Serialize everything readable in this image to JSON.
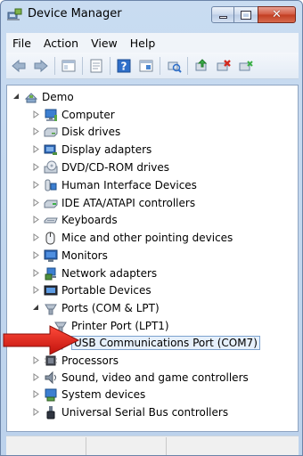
{
  "window": {
    "title": "Device Manager"
  },
  "menu": [
    "File",
    "Action",
    "View",
    "Help"
  ],
  "toolbar": {
    "buttons": [
      "back-icon",
      "forward-icon",
      "show-hide-tree-icon",
      "properties-icon",
      "help-icon",
      "view-icon",
      "scan-hardware-icon",
      "update-driver-icon",
      "uninstall-icon",
      "disable-icon"
    ]
  },
  "tree": {
    "root": "Demo",
    "items": [
      {
        "label": "Computer",
        "icon": "computer-icon",
        "state": "collapsed"
      },
      {
        "label": "Disk drives",
        "icon": "disk-drive-icon",
        "state": "collapsed"
      },
      {
        "label": "Display adapters",
        "icon": "display-adapter-icon",
        "state": "collapsed"
      },
      {
        "label": "DVD/CD-ROM drives",
        "icon": "dvd-drive-icon",
        "state": "collapsed"
      },
      {
        "label": "Human Interface Devices",
        "icon": "hid-icon",
        "state": "collapsed"
      },
      {
        "label": "IDE ATA/ATAPI controllers",
        "icon": "ide-controller-icon",
        "state": "collapsed"
      },
      {
        "label": "Keyboards",
        "icon": "keyboard-icon",
        "state": "collapsed"
      },
      {
        "label": "Mice and other pointing devices",
        "icon": "mouse-icon",
        "state": "collapsed"
      },
      {
        "label": "Monitors",
        "icon": "monitor-icon",
        "state": "collapsed"
      },
      {
        "label": "Network adapters",
        "icon": "network-adapter-icon",
        "state": "collapsed"
      },
      {
        "label": "Portable Devices",
        "icon": "portable-device-icon",
        "state": "collapsed"
      },
      {
        "label": "Ports (COM & LPT)",
        "icon": "port-icon",
        "state": "expanded"
      },
      {
        "label": "Printer Port (LPT1)",
        "icon": "port-icon",
        "state": "leaf"
      },
      {
        "label": "USB Communications Port (COM7)",
        "icon": "port-icon",
        "state": "leaf",
        "selected": true
      },
      {
        "label": "Processors",
        "icon": "processor-icon",
        "state": "collapsed"
      },
      {
        "label": "Sound, video and game controllers",
        "icon": "sound-icon",
        "state": "collapsed"
      },
      {
        "label": "System devices",
        "icon": "system-device-icon",
        "state": "collapsed"
      },
      {
        "label": "Universal Serial Bus controllers",
        "icon": "usb-icon",
        "state": "collapsed"
      }
    ]
  },
  "annotation": {
    "arrow_color": "#e0201c",
    "points_to": "USB Communications Port (COM7)"
  },
  "colors": {
    "title_bg": "#c9dcf1",
    "close_button": "#c94a30",
    "selection_border": "#7da2ce"
  }
}
